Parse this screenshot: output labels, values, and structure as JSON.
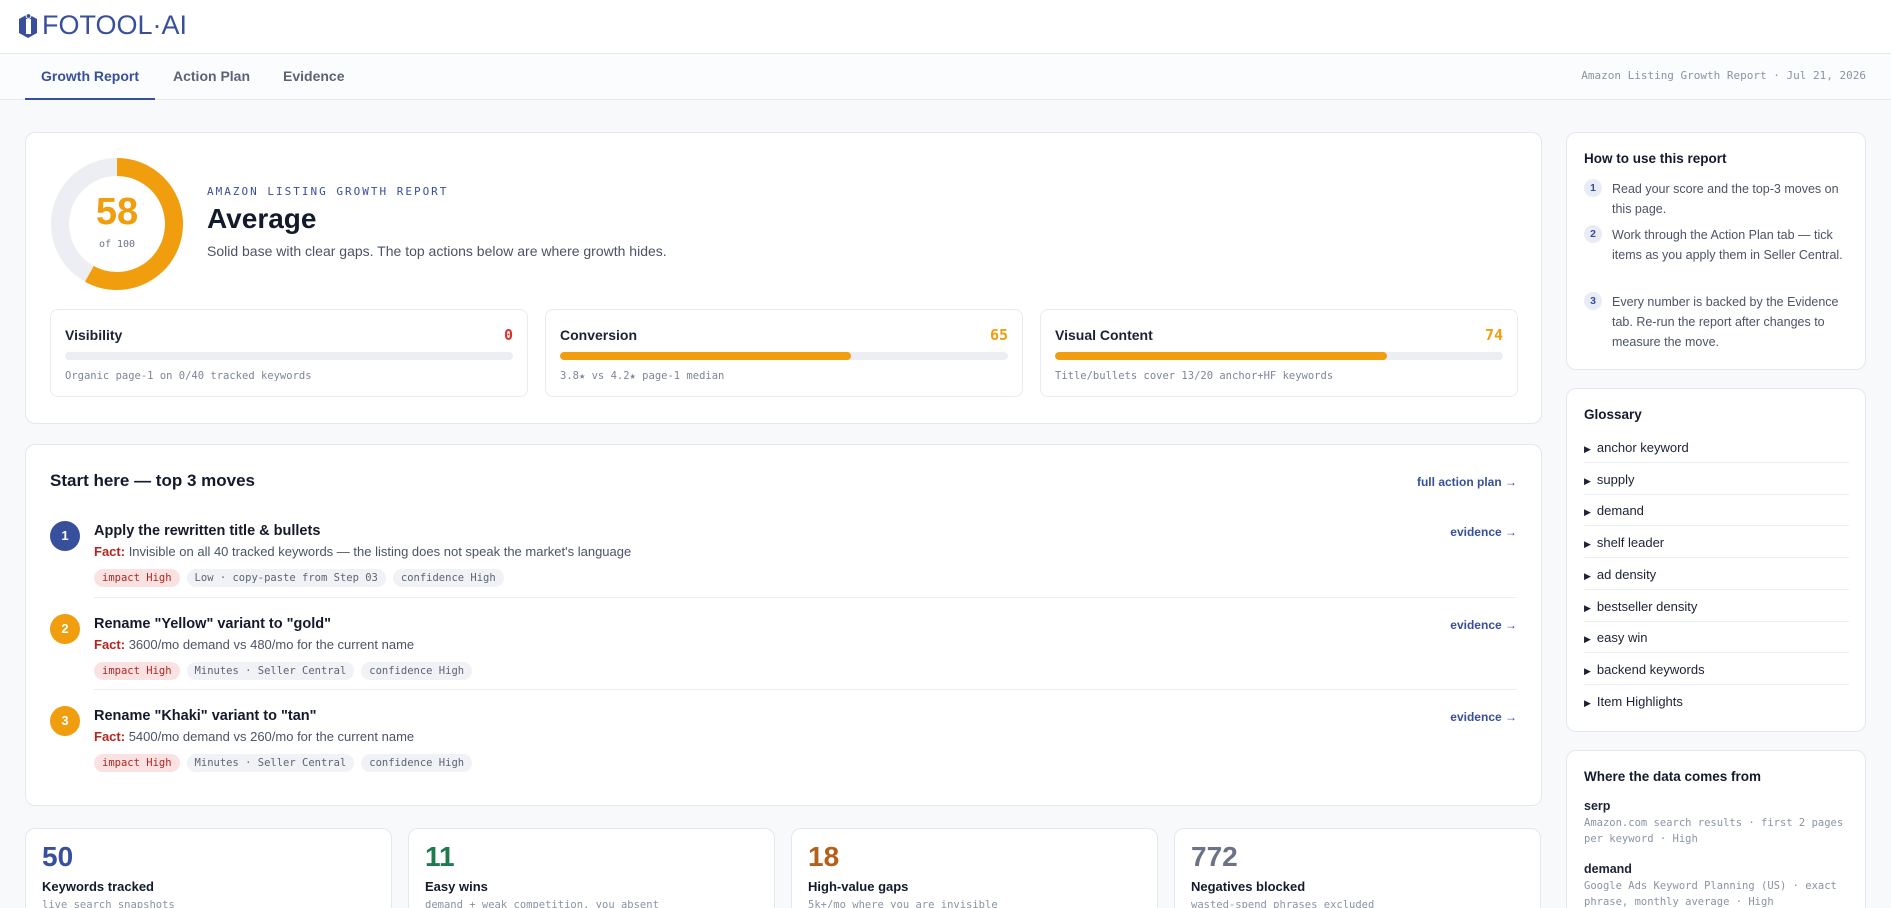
{
  "brand": {
    "name": "FOTOOL·AI",
    "accent": "#384f9c"
  },
  "tabs": [
    {
      "label": "Growth Report",
      "active": true
    },
    {
      "label": "Action Plan",
      "active": false
    },
    {
      "label": "Evidence",
      "active": false
    }
  ],
  "header_meta": "Amazon Listing Growth Report · Jul 21, 2026",
  "hero": {
    "score": "58",
    "score_value": 58,
    "score_of": "of 100",
    "eyebrow": "AMAZON LISTING GROWTH REPORT",
    "grade": "Average",
    "summary": "Solid base with clear gaps. The top actions below are where growth hides.",
    "score_color": "#f09d0e"
  },
  "metrics": [
    {
      "label": "Visibility",
      "value": "0",
      "fraction": 0.0,
      "color": "#d9342b",
      "note": "Organic page-1 on 0/40 tracked keywords"
    },
    {
      "label": "Conversion",
      "value": "65",
      "fraction": 0.65,
      "color": "#f09d0e",
      "note": "3.8★ vs 4.2★ page-1 median"
    },
    {
      "label": "Visual Content",
      "value": "74",
      "fraction": 0.74,
      "color": "#f09d0e",
      "note": "Title/bullets cover 13/20 anchor+HF keywords"
    }
  ],
  "moves": {
    "title": "Start here — top 3 moves",
    "full_plan_link": "full action plan →",
    "items": [
      {
        "num": "1",
        "color": "#384f9c",
        "title": "Apply the rewritten title & bullets",
        "fact_label": "Fact:",
        "fact": "Invisible on all 40 tracked keywords — the listing does not speak the market's language",
        "evidence": "evidence →",
        "chips": [
          "impact High",
          "Low · copy-paste from Step 03",
          "confidence High"
        ]
      },
      {
        "num": "2",
        "color": "#f09d0e",
        "title": "Rename \"Yellow\" variant to \"gold\"",
        "fact_label": "Fact:",
        "fact": "3600/mo demand vs 480/mo for the current name",
        "evidence": "evidence →",
        "chips": [
          "impact High",
          "Minutes · Seller Central",
          "confidence High"
        ]
      },
      {
        "num": "3",
        "color": "#f09d0e",
        "title": "Rename \"Khaki\" variant to \"tan\"",
        "fact_label": "Fact:",
        "fact": "5400/mo demand vs 260/mo for the current name",
        "evidence": "evidence →",
        "chips": [
          "impact High",
          "Minutes · Seller Central",
          "confidence High"
        ]
      }
    ]
  },
  "stats": [
    {
      "number": "50",
      "label": "Keywords tracked",
      "sub": "live search snapshots",
      "color": "#384f9c"
    },
    {
      "number": "11",
      "label": "Easy wins",
      "sub": "demand + weak competition, you absent",
      "color": "#1f7a4d"
    },
    {
      "number": "18",
      "label": "High-value gaps",
      "sub": "5k+/mo where you are invisible",
      "color": "#b5601a"
    },
    {
      "number": "772",
      "label": "Negatives blocked",
      "sub": "wasted-spend phrases excluded",
      "color": "#6b7385"
    }
  ],
  "howto": {
    "title": "How to use this report",
    "steps": [
      {
        "num": "1",
        "text": "Read your score and the top-3 moves on this page."
      },
      {
        "num": "2",
        "text": "Work through the Action Plan tab — tick items as you apply them in Seller Central."
      },
      {
        "num": "3",
        "text": "Every number is backed by the Evidence tab. Re-run the report after changes to measure the move."
      }
    ]
  },
  "glossary": {
    "title": "Glossary",
    "items": [
      "anchor keyword",
      "supply",
      "demand",
      "shelf leader",
      "ad density",
      "bestseller density",
      "easy win",
      "backend keywords",
      "Item Highlights"
    ]
  },
  "sources": {
    "title": "Where the data comes from",
    "items": [
      {
        "name": "serp",
        "desc": "Amazon.com search results · first 2 pages per keyword · High"
      },
      {
        "name": "demand",
        "desc": "Google Ads Keyword Planning (US) · exact phrase, monthly average · High"
      }
    ]
  }
}
